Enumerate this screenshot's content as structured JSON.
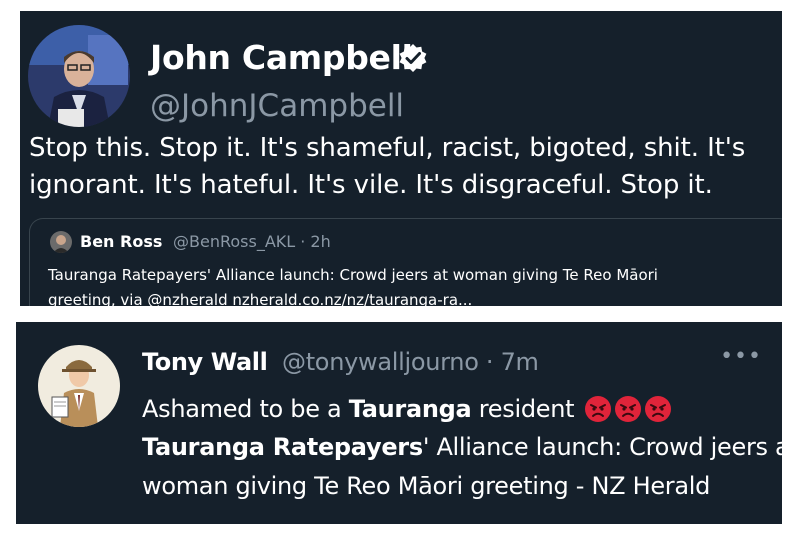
{
  "tweet1": {
    "display_name": "John Campbell",
    "handle": "@JohnJCampbell",
    "verified": true,
    "text_lines": [
      "Stop this. Stop it. It's shameful, racist, bigoted, shit. It's",
      "ignorant. It's hateful. It's vile. It's disgraceful. Stop it."
    ],
    "quoted": {
      "display_name": "Ben Ross",
      "handle_time": "@BenRoss_AKL · 2h",
      "text_lines": [
        "Tauranga Ratepayers' Alliance launch: Crowd jeers at woman giving Te Reo Māori",
        "greeting, via @nzherald nzherald.co.nz/nz/tauranga-ra..."
      ]
    }
  },
  "tweet2": {
    "display_name": "Tony Wall",
    "handle_time": "@tonywalljourno · 7m",
    "more_label": "•••",
    "line1_pre": "Ashamed to be a ",
    "line1_bold": "Tauranga",
    "line1_post": " resident",
    "emoji_name": "angry-face-emoji",
    "emoji_count": 3,
    "line2_bold": "Tauranga Ratepayers",
    "line2_post": "' Alliance launch: Crowd jeers at",
    "line3": "woman giving Te Reo Māori greeting - NZ Herald"
  },
  "colors": {
    "card_bg": "#15202b",
    "secondary_text": "#8b98a5",
    "border": "#38444d",
    "emoji_red": "#e0243a"
  }
}
